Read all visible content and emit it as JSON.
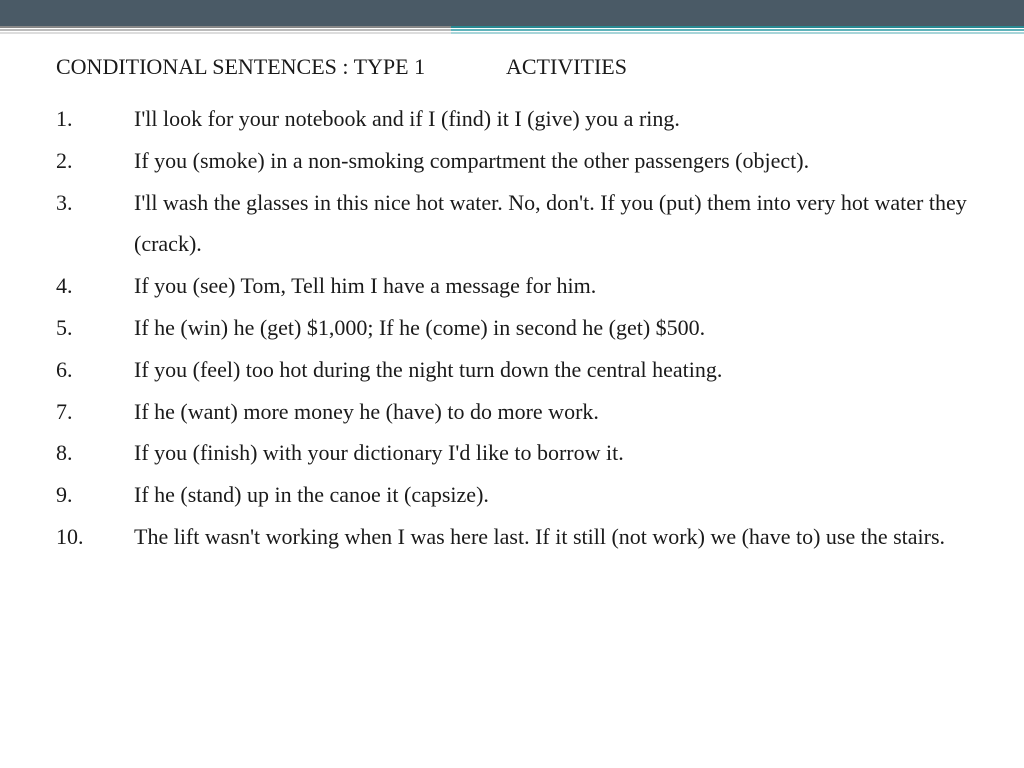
{
  "heading": {
    "left": "CONDITIONAL SENTENCES : TYPE 1",
    "right": "ACTIVITIES"
  },
  "items": [
    {
      "num": "1.",
      "text": "I'll look for your notebook and if I (find) it I (give) you a ring."
    },
    {
      "num": "2.",
      "text": "If you (smoke) in a non-smoking compartment the other passengers (object)."
    },
    {
      "num": "3.",
      "text": "I'll wash the glasses in this nice hot water. No, don't. If you (put) them into very hot water they (crack)."
    },
    {
      "num": "4.",
      "text": "If you (see) Tom, Tell him I have a message for him."
    },
    {
      "num": "5.",
      "text": "If he (win) he (get) $1,000; If he (come) in second he (get) $500."
    },
    {
      "num": "6.",
      "text": "If you (feel) too hot during the night turn down the central heating."
    },
    {
      "num": "7.",
      "text": "If he (want) more money he (have) to do more work."
    },
    {
      "num": "8.",
      "text": "If you (finish) with your dictionary I'd like to borrow it."
    },
    {
      "num": "9.",
      "text": "If he (stand) up in the canoe it (capsize)."
    },
    {
      "num": "10.",
      "text": "The lift wasn't working when I was here last. If it still (not work) we (have to) use the stairs."
    }
  ]
}
